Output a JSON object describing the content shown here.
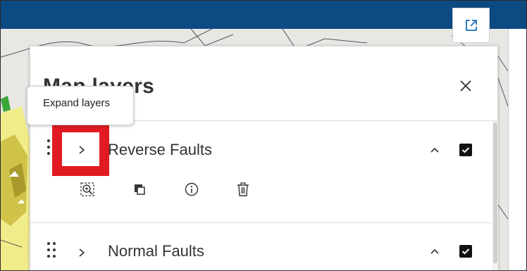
{
  "panel": {
    "title": "Map layers",
    "close_label": "Close"
  },
  "tooltip": {
    "text": "Expand layers"
  },
  "layers": [
    {
      "title": "Reverse Faults",
      "visible": true,
      "expanded": false
    },
    {
      "title": "Normal Faults",
      "visible": true,
      "expanded": false
    }
  ],
  "actions": [
    {
      "icon": "zoom-to-icon"
    },
    {
      "icon": "copy-icon"
    },
    {
      "icon": "info-icon"
    },
    {
      "icon": "trash-icon"
    }
  ],
  "colors": {
    "topbar": "#0c4a82",
    "highlight": "#e11b22",
    "map_background": "#e7e7e4",
    "map_yellow": "#f1ec8a",
    "map_olive": "#c8b93a"
  }
}
